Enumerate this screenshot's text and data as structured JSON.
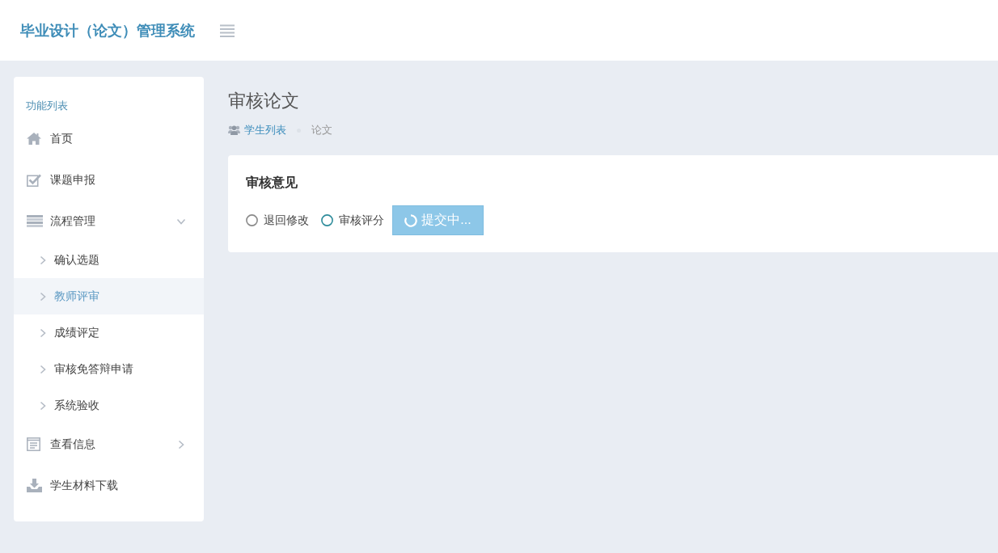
{
  "header": {
    "title": "毕业设计（论文）管理系统"
  },
  "sidebar": {
    "heading": "功能列表",
    "items": [
      {
        "label": "首页",
        "kind": "link",
        "selected": false
      },
      {
        "label": "课题申报",
        "kind": "link",
        "selected": false
      },
      {
        "label": "流程管理",
        "kind": "group",
        "selected": false,
        "expanded": true,
        "children": [
          {
            "label": "确认选题",
            "selected": false
          },
          {
            "label": "教师评审",
            "selected": true
          },
          {
            "label": "成绩评定",
            "selected": false
          },
          {
            "label": "审核免答辩申请",
            "selected": false
          },
          {
            "label": "系统验收",
            "selected": false
          }
        ]
      },
      {
        "label": "查看信息",
        "kind": "group",
        "selected": false,
        "expanded": false
      },
      {
        "label": "学生材料下载",
        "kind": "link",
        "selected": false
      }
    ]
  },
  "page": {
    "title": "审核论文",
    "breadcrumb": [
      {
        "label": "学生列表",
        "kind": "link"
      },
      {
        "label": "论文",
        "kind": "current"
      }
    ]
  },
  "card": {
    "heading": "审核意见",
    "options": [
      {
        "label": "退回修改",
        "selected": false
      },
      {
        "label": "审核评分",
        "selected": true
      }
    ],
    "submit": {
      "label": "提交中...",
      "loading": true
    }
  }
}
